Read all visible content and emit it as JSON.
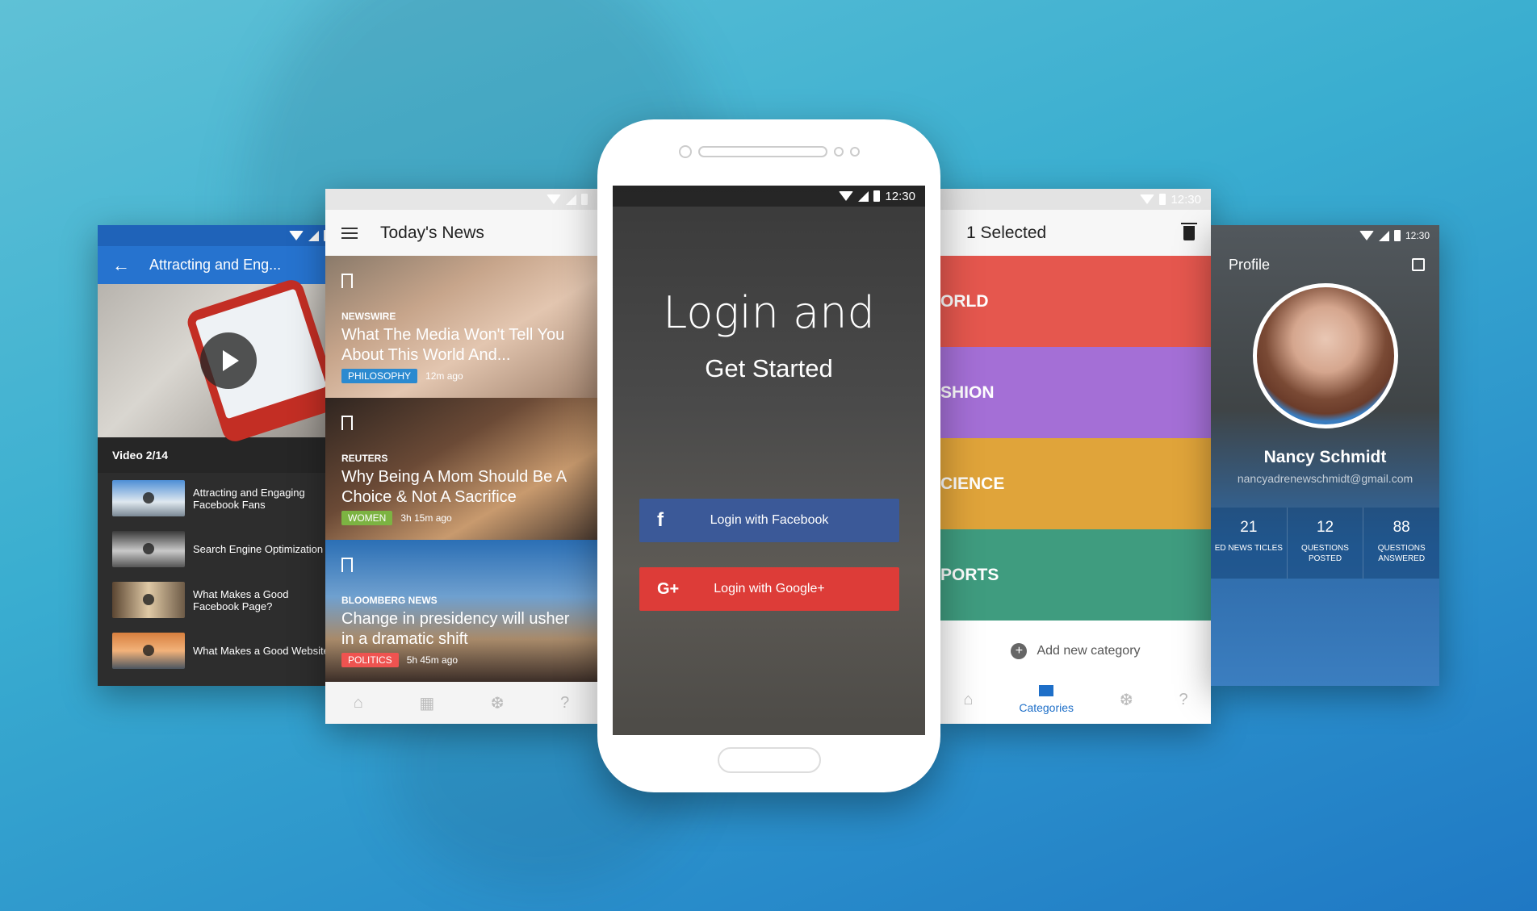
{
  "colors": {
    "facebook": "#3b5998",
    "google": "#dd3c38",
    "primary_blue": "#2673cf"
  },
  "status_time": "12:30",
  "video_screen": {
    "title": "Attracting and Eng...",
    "video_count": "Video 2/14",
    "items": [
      {
        "label": "Attracting and Engaging Facebook Fans"
      },
      {
        "label": "Search Engine Optimization"
      },
      {
        "label": "What Makes a Good Facebook Page?"
      },
      {
        "label": "What Makes a Good Website"
      }
    ]
  },
  "news_screen": {
    "title": "Today's News",
    "cards": [
      {
        "source": "NEWSWIRE",
        "headline": "What The Media Won't Tell You About This World And...",
        "tag": "PHILOSOPHY",
        "tag_color": "#2b8ad0",
        "time": "12m ago"
      },
      {
        "source": "REUTERS",
        "headline": "Why Being A Mom Should Be A Choice & Not A Sacrifice",
        "tag": "WOMEN",
        "tag_color": "#7cb342",
        "time": "3h 15m ago"
      },
      {
        "source": "BLOOMBERG NEWS",
        "headline": "Change in presidency will usher in a dramatic shift",
        "tag": "POLITICS",
        "tag_color": "#ef5350",
        "time": "5h 45m ago"
      }
    ],
    "nav_icons": [
      "home-icon",
      "categories-icon",
      "rss-icon",
      "help-icon"
    ]
  },
  "login_screen": {
    "title_line1": "Login and",
    "title_line2": "Get Started",
    "facebook_button": "Login with Facebook",
    "google_button": "Login with Google+",
    "facebook_glyph": "f",
    "google_glyph": "G+"
  },
  "categories_screen": {
    "title": "1 Selected",
    "categories": [
      {
        "label": "ORLD",
        "color": "#e5574e"
      },
      {
        "label": "SHION",
        "color": "#a46fd6"
      },
      {
        "label": "CIENCE",
        "color": "#e0a43a"
      },
      {
        "label": "PORTS",
        "color": "#3f9c7f"
      }
    ],
    "add_label": "Add new category",
    "active_nav": "Categories"
  },
  "profile_screen": {
    "title": "Profile",
    "name": "Nancy Schmidt",
    "email": "nancyadrenewschmidt@gmail.com",
    "stats": [
      {
        "value": "21",
        "label": "ED NEWS TICLES"
      },
      {
        "value": "12",
        "label": "QUESTIONS POSTED"
      },
      {
        "value": "88",
        "label": "QUESTIONS ANSWERED"
      }
    ]
  }
}
